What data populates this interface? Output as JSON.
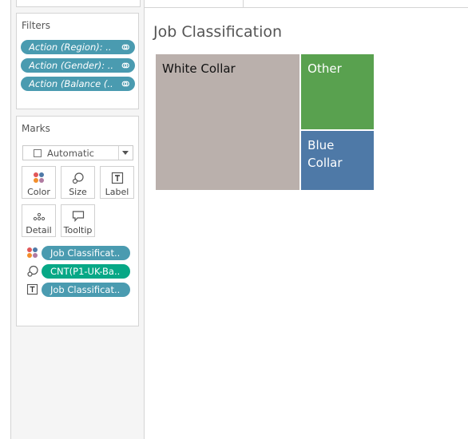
{
  "filters": {
    "title": "Filters",
    "pills": [
      {
        "label": "Action (Region): ..",
        "icon": "link-icon"
      },
      {
        "label": "Action (Gender): ..",
        "icon": "link-icon"
      },
      {
        "label": "Action (Balance (..",
        "icon": "link-icon"
      }
    ]
  },
  "marks": {
    "title": "Marks",
    "type": "Automatic",
    "buttons": [
      {
        "label": "Color",
        "icon": "color-icon"
      },
      {
        "label": "Size",
        "icon": "size-icon"
      },
      {
        "label": "Label",
        "icon": "label-icon"
      },
      {
        "label": "Detail",
        "icon": "detail-icon"
      },
      {
        "label": "Tooltip",
        "icon": "tooltip-icon"
      }
    ],
    "fields": [
      {
        "label": "Job Classificat..",
        "encoding": "color",
        "color": "#4a9bb0"
      },
      {
        "label": "CNT(P1-UK-Ba..",
        "encoding": "size",
        "color": "#07a886"
      },
      {
        "label": "Job Classificat..",
        "encoding": "label",
        "color": "#4a9bb0"
      }
    ]
  },
  "view": {
    "title": "Job Classification"
  },
  "chart_data": {
    "type": "treemap",
    "title": "Job Classification",
    "categories": [
      "White Collar",
      "Other",
      "Blue Collar"
    ],
    "values": [
      0.66,
      0.19,
      0.15
    ],
    "colors": {
      "White Collar": "#bab0ac",
      "Other": "#59a14f",
      "Blue Collar": "#4e79a7"
    },
    "label_colors": {
      "White Collar": "#111111",
      "Other": "#ffffff",
      "Blue Collar": "#ffffff"
    }
  }
}
